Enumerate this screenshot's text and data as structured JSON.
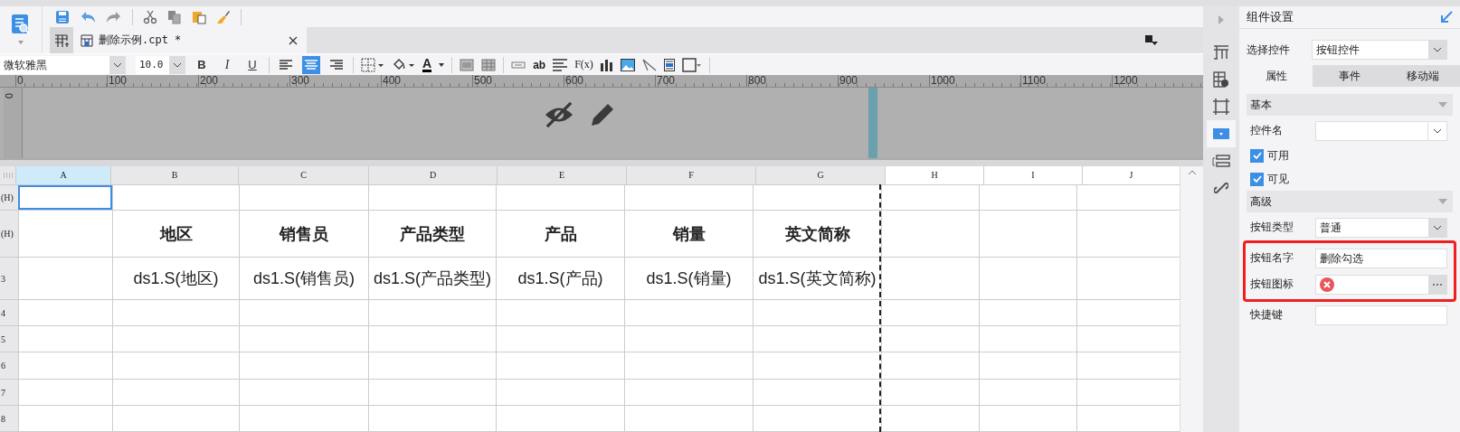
{
  "file_tab": {
    "label": "删除示例.cpt *"
  },
  "format_toolbar": {
    "font": "微软雅黑",
    "size": "10.0",
    "style_buttons": [
      "B",
      "I",
      "U"
    ],
    "align_buttons": [
      {
        "selected": false
      },
      {
        "selected": true
      },
      {
        "selected": false
      }
    ],
    "font_color_label": "A",
    "text_tool_label": "ab",
    "formula_label": "F(x)"
  },
  "ruler": {
    "marks": [
      "0",
      "100",
      "200",
      "300",
      "400",
      "500",
      "600",
      "700",
      "800",
      "900",
      "1000",
      "1100",
      "1200"
    ],
    "vertical_mark": "0"
  },
  "sheet": {
    "columns": [
      {
        "label": "A",
        "selected": true
      },
      {
        "label": "B",
        "selected": false
      },
      {
        "label": "C",
        "selected": false
      },
      {
        "label": "D",
        "selected": false
      },
      {
        "label": "E",
        "selected": false
      },
      {
        "label": "F",
        "selected": false
      },
      {
        "label": "G",
        "selected": false
      },
      {
        "label": "H",
        "selected": false
      },
      {
        "label": "I",
        "selected": false
      },
      {
        "label": "J",
        "selected": false
      }
    ],
    "rows": [
      {
        "label": "(H)",
        "kind": "blank",
        "selected": true
      },
      {
        "label": "(H)",
        "kind": "header",
        "selected": false,
        "cells": [
          "地区",
          "销售员",
          "产品类型",
          "产品",
          "销量",
          "英文简称"
        ]
      },
      {
        "label": "3",
        "kind": "field",
        "selected": false,
        "cells": [
          "ds1.S(地区)",
          "ds1.S(销售员)",
          "ds1.S(产品类型)",
          "ds1.S(产品)",
          "ds1.S(销量)",
          "ds1.S(英文简称)"
        ]
      },
      {
        "label": "4",
        "kind": "blank",
        "selected": false
      },
      {
        "label": "5",
        "kind": "blank",
        "selected": false
      },
      {
        "label": "6",
        "kind": "blank",
        "selected": false
      },
      {
        "label": "7",
        "kind": "blank",
        "selected": false
      },
      {
        "label": "8",
        "kind": "blank",
        "selected": false
      }
    ]
  },
  "side_icons": [
    {
      "selected": false
    },
    {
      "selected": false
    },
    {
      "selected": false
    },
    {
      "selected": true
    },
    {
      "selected": false
    },
    {
      "selected": false
    }
  ],
  "panel": {
    "title": "组件设置",
    "select": {
      "label": "选择控件",
      "value": "按钮控件"
    },
    "tabs": [
      {
        "label": "属性",
        "selected": true
      },
      {
        "label": "事件",
        "selected": false
      },
      {
        "label": "移动端",
        "selected": false
      }
    ],
    "sections": [
      {
        "title": "基本",
        "fields": [
          {
            "kind": "combo",
            "label": "控件名",
            "highlighted": false
          },
          {
            "kind": "checkbox",
            "label": "可用",
            "checked": true,
            "highlighted": false
          },
          {
            "kind": "checkbox",
            "label": "可见",
            "checked": true,
            "highlighted": false
          }
        ]
      },
      {
        "title": "高级",
        "fields": [
          {
            "kind": "combo",
            "label": "按钮类型",
            "value": "普通",
            "highlighted": false
          },
          {
            "kind": "text",
            "label": "按钮名字",
            "value": "删除勾选",
            "highlighted": true
          },
          {
            "kind": "icon",
            "label": "按钮图标",
            "highlighted": true
          },
          {
            "kind": "text",
            "label": "快捷键",
            "highlighted": false
          }
        ]
      }
    ]
  }
}
